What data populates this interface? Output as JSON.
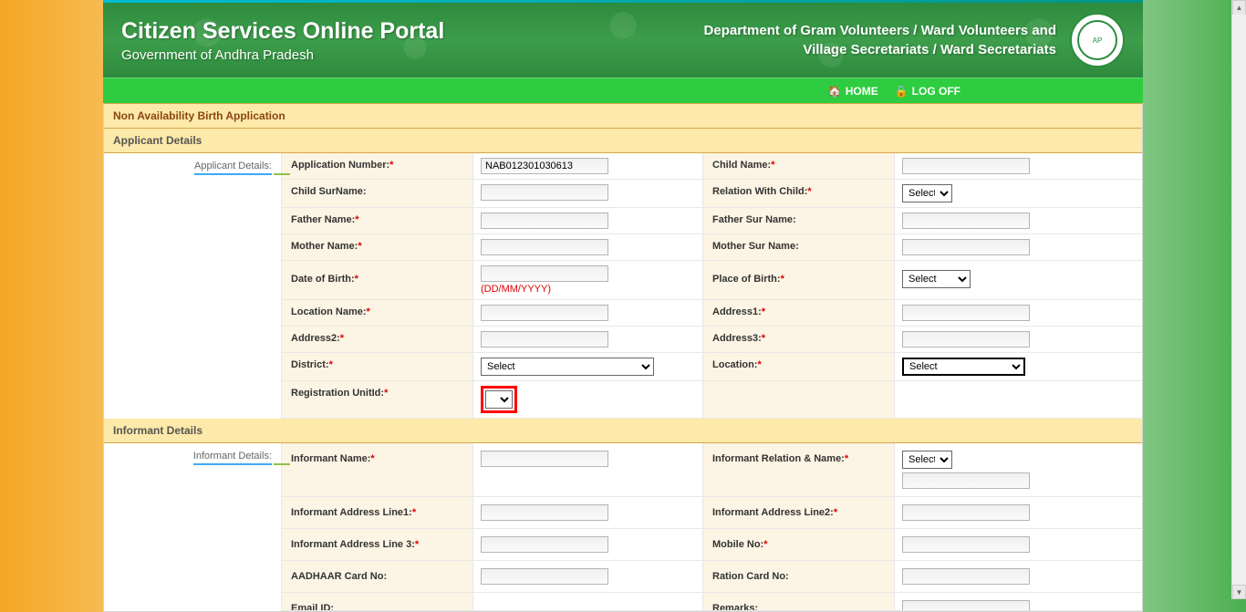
{
  "header": {
    "title": "Citizen Services Online Portal",
    "subtitle": "Government of Andhra Pradesh",
    "dept_line1": "Department of Gram Volunteers / Ward Volunteers and",
    "dept_line2": "Village Secretariats / Ward Secretariats"
  },
  "nav": {
    "home": "HOME",
    "logoff": "LOG OFF"
  },
  "sections": {
    "app_title": "Non Availability Birth Application",
    "applicant_details": "Applicant Details",
    "applicant_side": "Applicant Details:",
    "informant_details": "Informant Details",
    "informant_side": "Informant Details:"
  },
  "labels": {
    "app_no": "Application Number:",
    "child_name": "Child Name:",
    "child_surname": "Child SurName:",
    "relation_child": "Relation With Child:",
    "father_name": "Father Name:",
    "father_surname": "Father Sur Name:",
    "mother_name": "Mother Name:",
    "mother_surname": "Mother Sur Name:",
    "dob": "Date of Birth:",
    "date_hint": "(DD/MM/YYYY)",
    "pob": "Place of Birth:",
    "loc_name": "Location Name:",
    "addr1": "Address1:",
    "addr2": "Address2:",
    "addr3": "Address3:",
    "district": "District:",
    "location": "Location:",
    "reg_unit": "Registration UnitId:",
    "inf_name": "Informant Name:",
    "inf_rel": "Informant Relation & Name:",
    "inf_addr1": "Informant Address Line1:",
    "inf_addr2": "Informant Address Line2:",
    "inf_addr3": "Informant Address Line 3:",
    "mobile": "Mobile No:",
    "aadhaar": "AADHAAR Card No:",
    "ration": "Ration Card No:",
    "email": "Email ID:",
    "remarks": "Remarks:"
  },
  "values": {
    "app_no": "NAB012301030613",
    "select": "Select"
  }
}
